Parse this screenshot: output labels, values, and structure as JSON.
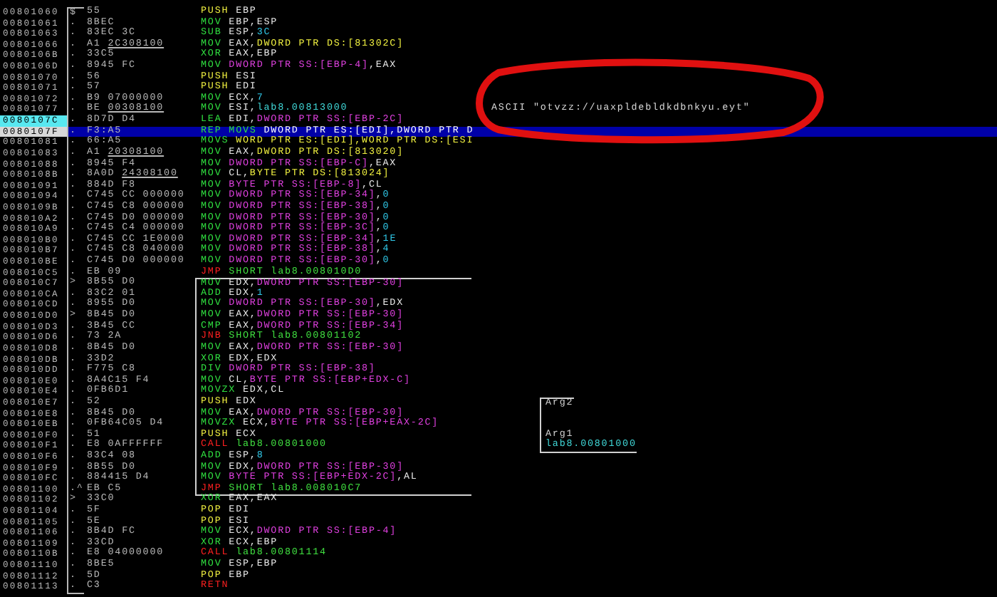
{
  "listing": {
    "function_bracket": true,
    "annotation": {
      "kind": "circle",
      "color": "#e01010"
    },
    "rows": [
      {
        "kind": "plain",
        "address": "00801060",
        "mark": "$",
        "hex": "55",
        "op": {
          "text": "PUSH",
          "kind": "stack"
        },
        "args": [
          {
            "text": "EBP",
            "kind": "register"
          }
        ],
        "selected": false,
        "address_highlight": false
      },
      {
        "kind": "plain",
        "address": "00801061",
        "mark": ".",
        "hex": "8BEC",
        "op": {
          "text": "MOV",
          "kind": "move"
        },
        "args": [
          {
            "text": "EBP,ESP",
            "kind": "register"
          }
        ],
        "selected": false,
        "address_highlight": false
      },
      {
        "kind": "plain",
        "address": "00801063",
        "mark": ".",
        "hex": "83EC 3C",
        "op": {
          "text": "SUB",
          "kind": "move"
        },
        "args": [
          {
            "text": "ESP,",
            "kind": "register"
          },
          {
            "text": "3C",
            "kind": "immediate"
          }
        ],
        "selected": false,
        "address_highlight": false
      },
      {
        "kind": "plain",
        "address": "00801066",
        "mark": ".",
        "hex": "A1",
        "fixup": "2C308100",
        "op": {
          "text": "MOV",
          "kind": "move"
        },
        "args": [
          {
            "text": "EAX,",
            "kind": "register"
          },
          {
            "text": "DWORD PTR DS:[81302C]",
            "kind": "global"
          }
        ],
        "selected": false,
        "address_highlight": false
      },
      {
        "kind": "plain",
        "address": "0080106B",
        "mark": ".",
        "hex": "33C5",
        "op": {
          "text": "XOR",
          "kind": "move"
        },
        "args": [
          {
            "text": "EAX,EBP",
            "kind": "register"
          }
        ],
        "selected": false,
        "address_highlight": false
      },
      {
        "kind": "plain",
        "address": "0080106D",
        "mark": ".",
        "hex": "8945 FC",
        "op": {
          "text": "MOV",
          "kind": "move"
        },
        "args": [
          {
            "text": "DWORD PTR SS:[EBP-4]",
            "kind": "memory"
          },
          {
            "text": ",EAX",
            "kind": "register"
          }
        ],
        "selected": false,
        "address_highlight": false
      },
      {
        "kind": "plain",
        "address": "00801070",
        "mark": ".",
        "hex": "56",
        "op": {
          "text": "PUSH",
          "kind": "stack"
        },
        "args": [
          {
            "text": "ESI",
            "kind": "register"
          }
        ],
        "selected": false,
        "address_highlight": false
      },
      {
        "kind": "plain",
        "address": "00801071",
        "mark": ".",
        "hex": "57",
        "op": {
          "text": "PUSH",
          "kind": "stack"
        },
        "args": [
          {
            "text": "EDI",
            "kind": "register"
          }
        ],
        "selected": false,
        "address_highlight": false
      },
      {
        "kind": "plain",
        "address": "00801072",
        "mark": ".",
        "hex": "B9 07000000",
        "op": {
          "text": "MOV",
          "kind": "move"
        },
        "args": [
          {
            "text": "ECX,",
            "kind": "register"
          },
          {
            "text": "7",
            "kind": "immediate"
          }
        ],
        "selected": false,
        "address_highlight": false
      },
      {
        "kind": "plain",
        "address": "00801077",
        "mark": ".",
        "hex": "BE",
        "fixup": "00308100",
        "op": {
          "text": "MOV",
          "kind": "move"
        },
        "args": [
          {
            "text": "ESI,",
            "kind": "register"
          },
          {
            "text": "lab8.00813000",
            "kind": "symbol"
          }
        ],
        "comment": {
          "text": "ASCII \"otvzz://uaxpldebldkdbnkyu.eyt\"",
          "kind": "ascii"
        },
        "selected": false,
        "address_highlight": false
      },
      {
        "kind": "plain",
        "address": "0080107C",
        "mark": ".",
        "hex": "8D7D D4",
        "op": {
          "text": "LEA",
          "kind": "move"
        },
        "args": [
          {
            "text": "EDI,",
            "kind": "register"
          },
          {
            "text": "DWORD PTR SS:[EBP-2C]",
            "kind": "memory"
          }
        ],
        "selected": false,
        "address_highlight": true
      },
      {
        "kind": "plain",
        "address": "0080107F",
        "mark": ".",
        "hex": "F3:A5",
        "op": {
          "text": "REP MOVS",
          "kind": "move"
        },
        "args": [
          {
            "text": "DWORD PTR ES:[EDI],DWORD PTR D",
            "kind": "register"
          }
        ],
        "selected": true,
        "address_highlight": false
      },
      {
        "kind": "plain",
        "address": "00801081",
        "mark": ".",
        "hex": "66:A5",
        "op": {
          "text": "MOVS",
          "kind": "move"
        },
        "args": [
          {
            "text": "WORD PTR ES:[EDI],WORD PTR DS:[ESI",
            "kind": "global"
          }
        ],
        "selected": false,
        "address_highlight": false
      },
      {
        "kind": "plain",
        "address": "00801083",
        "mark": ".",
        "hex": "A1",
        "fixup": "20308100",
        "op": {
          "text": "MOV",
          "kind": "move"
        },
        "args": [
          {
            "text": "EAX,",
            "kind": "register"
          },
          {
            "text": "DWORD PTR DS:[813020]",
            "kind": "global"
          }
        ],
        "selected": false,
        "address_highlight": false
      },
      {
        "kind": "plain",
        "address": "00801088",
        "mark": ".",
        "hex": "8945 F4",
        "op": {
          "text": "MOV",
          "kind": "move"
        },
        "args": [
          {
            "text": "DWORD PTR SS:[EBP-C]",
            "kind": "memory"
          },
          {
            "text": ",EAX",
            "kind": "register"
          }
        ],
        "selected": false,
        "address_highlight": false
      },
      {
        "kind": "plain",
        "address": "0080108B",
        "mark": ".",
        "hex": "8A0D",
        "fixup": "24308100",
        "op": {
          "text": "MOV",
          "kind": "move"
        },
        "args": [
          {
            "text": "CL,",
            "kind": "register"
          },
          {
            "text": "BYTE PTR DS:[813024]",
            "kind": "global"
          }
        ],
        "selected": false,
        "address_highlight": false
      },
      {
        "kind": "plain",
        "address": "00801091",
        "mark": ".",
        "hex": "884D F8",
        "op": {
          "text": "MOV",
          "kind": "move"
        },
        "args": [
          {
            "text": "BYTE PTR SS:[EBP-8]",
            "kind": "memory"
          },
          {
            "text": ",CL",
            "kind": "register"
          }
        ],
        "selected": false,
        "address_highlight": false
      },
      {
        "kind": "plain",
        "address": "00801094",
        "mark": ".",
        "hex": "C745 CC 000000",
        "op": {
          "text": "MOV",
          "kind": "move"
        },
        "args": [
          {
            "text": "DWORD PTR SS:[EBP-34]",
            "kind": "memory"
          },
          {
            "text": ",",
            "kind": "register"
          },
          {
            "text": "0",
            "kind": "immediate"
          }
        ],
        "selected": false,
        "address_highlight": false
      },
      {
        "kind": "plain",
        "address": "0080109B",
        "mark": ".",
        "hex": "C745 C8 000000",
        "op": {
          "text": "MOV",
          "kind": "move"
        },
        "args": [
          {
            "text": "DWORD PTR SS:[EBP-38]",
            "kind": "memory"
          },
          {
            "text": ",",
            "kind": "register"
          },
          {
            "text": "0",
            "kind": "immediate"
          }
        ],
        "selected": false,
        "address_highlight": false
      },
      {
        "kind": "plain",
        "address": "008010A2",
        "mark": ".",
        "hex": "C745 D0 000000",
        "op": {
          "text": "MOV",
          "kind": "move"
        },
        "args": [
          {
            "text": "DWORD PTR SS:[EBP-30]",
            "kind": "memory"
          },
          {
            "text": ",",
            "kind": "register"
          },
          {
            "text": "0",
            "kind": "immediate"
          }
        ],
        "selected": false,
        "address_highlight": false
      },
      {
        "kind": "plain",
        "address": "008010A9",
        "mark": ".",
        "hex": "C745 C4 000000",
        "op": {
          "text": "MOV",
          "kind": "move"
        },
        "args": [
          {
            "text": "DWORD PTR SS:[EBP-3C]",
            "kind": "memory"
          },
          {
            "text": ",",
            "kind": "register"
          },
          {
            "text": "0",
            "kind": "immediate"
          }
        ],
        "selected": false,
        "address_highlight": false
      },
      {
        "kind": "plain",
        "address": "008010B0",
        "mark": ".",
        "hex": "C745 CC 1E0000",
        "op": {
          "text": "MOV",
          "kind": "move"
        },
        "args": [
          {
            "text": "DWORD PTR SS:[EBP-34]",
            "kind": "memory"
          },
          {
            "text": ",",
            "kind": "register"
          },
          {
            "text": "1E",
            "kind": "immediate"
          }
        ],
        "selected": false,
        "address_highlight": false
      },
      {
        "kind": "plain",
        "address": "008010B7",
        "mark": ".",
        "hex": "C745 C8 040000",
        "op": {
          "text": "MOV",
          "kind": "move"
        },
        "args": [
          {
            "text": "DWORD PTR SS:[EBP-38]",
            "kind": "memory"
          },
          {
            "text": ",",
            "kind": "register"
          },
          {
            "text": "4",
            "kind": "immediate"
          }
        ],
        "selected": false,
        "address_highlight": false
      },
      {
        "kind": "plain",
        "address": "008010BE",
        "mark": ".",
        "hex": "C745 D0 000000",
        "op": {
          "text": "MOV",
          "kind": "move"
        },
        "args": [
          {
            "text": "DWORD PTR SS:[EBP-30]",
            "kind": "memory"
          },
          {
            "text": ",",
            "kind": "register"
          },
          {
            "text": "0",
            "kind": "immediate"
          }
        ],
        "selected": false,
        "address_highlight": false
      },
      {
        "kind": "plain",
        "address": "008010C5",
        "mark": ".",
        "hex": "EB 09",
        "op": {
          "text": "JMP",
          "kind": "jump"
        },
        "args": [
          {
            "text": "SHORT lab8.008010D0",
            "kind": "target"
          }
        ],
        "selected": false,
        "address_highlight": false
      },
      {
        "kind": "loopstart",
        "address": "008010C7",
        "mark": ">",
        "hex": "8B55 D0",
        "op": {
          "text": "MOV",
          "kind": "move"
        },
        "args": [
          {
            "text": "EDX,",
            "kind": "register"
          },
          {
            "text": "DWORD PTR SS:[EBP-30]",
            "kind": "memory"
          }
        ],
        "selected": false,
        "address_highlight": false
      },
      {
        "kind": "loop",
        "address": "008010CA",
        "mark": ".",
        "hex": "83C2 01",
        "op": {
          "text": "ADD",
          "kind": "move"
        },
        "args": [
          {
            "text": "EDX,",
            "kind": "register"
          },
          {
            "text": "1",
            "kind": "immediate"
          }
        ],
        "selected": false,
        "address_highlight": false
      },
      {
        "kind": "loop",
        "address": "008010CD",
        "mark": ".",
        "hex": "8955 D0",
        "op": {
          "text": "MOV",
          "kind": "move"
        },
        "args": [
          {
            "text": "DWORD PTR SS:[EBP-30]",
            "kind": "memory"
          },
          {
            "text": ",EDX",
            "kind": "register"
          }
        ],
        "selected": false,
        "address_highlight": false
      },
      {
        "kind": "loop",
        "address": "008010D0",
        "mark": ">",
        "hex": "8B45 D0",
        "op": {
          "text": "MOV",
          "kind": "move"
        },
        "args": [
          {
            "text": "EAX,",
            "kind": "register"
          },
          {
            "text": "DWORD PTR SS:[EBP-30]",
            "kind": "memory"
          }
        ],
        "selected": false,
        "address_highlight": false
      },
      {
        "kind": "loop",
        "address": "008010D3",
        "mark": ".",
        "hex": "3B45 CC",
        "op": {
          "text": "CMP",
          "kind": "move"
        },
        "args": [
          {
            "text": "EAX,",
            "kind": "register"
          },
          {
            "text": "DWORD PTR SS:[EBP-34]",
            "kind": "memory"
          }
        ],
        "selected": false,
        "address_highlight": false
      },
      {
        "kind": "loop",
        "address": "008010D6",
        "mark": ".",
        "hex": "73 2A",
        "op": {
          "text": "JNB",
          "kind": "jump"
        },
        "args": [
          {
            "text": "SHORT lab8.00801102",
            "kind": "target"
          }
        ],
        "selected": false,
        "address_highlight": false
      },
      {
        "kind": "loop",
        "address": "008010D8",
        "mark": ".",
        "hex": "8B45 D0",
        "op": {
          "text": "MOV",
          "kind": "move"
        },
        "args": [
          {
            "text": "EAX,",
            "kind": "register"
          },
          {
            "text": "DWORD PTR SS:[EBP-30]",
            "kind": "memory"
          }
        ],
        "selected": false,
        "address_highlight": false
      },
      {
        "kind": "loop",
        "address": "008010DB",
        "mark": ".",
        "hex": "33D2",
        "op": {
          "text": "XOR",
          "kind": "move"
        },
        "args": [
          {
            "text": "EDX,EDX",
            "kind": "register"
          }
        ],
        "selected": false,
        "address_highlight": false
      },
      {
        "kind": "loop",
        "address": "008010DD",
        "mark": ".",
        "hex": "F775 C8",
        "op": {
          "text": "DIV",
          "kind": "move"
        },
        "args": [
          {
            "text": "DWORD PTR SS:[EBP-38]",
            "kind": "memory"
          }
        ],
        "selected": false,
        "address_highlight": false
      },
      {
        "kind": "loop",
        "address": "008010E0",
        "mark": ".",
        "hex": "8A4C15 F4",
        "op": {
          "text": "MOV",
          "kind": "move"
        },
        "args": [
          {
            "text": "CL,",
            "kind": "register"
          },
          {
            "text": "BYTE PTR SS:[EBP+EDX-C]",
            "kind": "memory"
          }
        ],
        "selected": false,
        "address_highlight": false
      },
      {
        "kind": "loop",
        "address": "008010E4",
        "mark": ".",
        "hex": "0FB6D1",
        "op": {
          "text": "MOVZX",
          "kind": "move"
        },
        "args": [
          {
            "text": "EDX,CL",
            "kind": "register"
          }
        ],
        "selected": false,
        "address_highlight": false
      },
      {
        "kind": "loop",
        "address": "008010E7",
        "mark": ".",
        "hex": "52",
        "op": {
          "text": "PUSH",
          "kind": "stack"
        },
        "args": [
          {
            "text": "EDX",
            "kind": "register"
          }
        ],
        "comment": {
          "text": "Arg2",
          "kind": "open"
        },
        "selected": false,
        "address_highlight": false
      },
      {
        "kind": "loop",
        "address": "008010E8",
        "mark": ".",
        "hex": "8B45 D0",
        "op": {
          "text": "MOV",
          "kind": "move"
        },
        "args": [
          {
            "text": "EAX,",
            "kind": "register"
          },
          {
            "text": "DWORD PTR SS:[EBP-30]",
            "kind": "memory"
          }
        ],
        "comment": {
          "kind": "inner"
        },
        "selected": false,
        "address_highlight": false
      },
      {
        "kind": "loop",
        "address": "008010EB",
        "mark": ".",
        "hex": "0FB64C05 D4",
        "op": {
          "text": "MOVZX",
          "kind": "move"
        },
        "args": [
          {
            "text": "ECX,",
            "kind": "register"
          },
          {
            "text": "BYTE PTR SS:[EBP+EAX-2C]",
            "kind": "memory"
          }
        ],
        "comment": {
          "kind": "inner"
        },
        "selected": false,
        "address_highlight": false
      },
      {
        "kind": "loop",
        "address": "008010F0",
        "mark": ".",
        "hex": "51",
        "op": {
          "text": "PUSH",
          "kind": "stack"
        },
        "args": [
          {
            "text": "ECX",
            "kind": "register"
          }
        ],
        "comment": {
          "text": "Arg1",
          "kind": "inner"
        },
        "selected": false,
        "address_highlight": false
      },
      {
        "kind": "loop",
        "address": "008010F1",
        "mark": ".",
        "hex": "E8 0AFFFFFF",
        "op": {
          "text": "CALL",
          "kind": "call"
        },
        "args": [
          {
            "text": "lab8.00801000",
            "kind": "target"
          }
        ],
        "comment": {
          "text": "lab8.00801000",
          "kind": "close"
        },
        "selected": false,
        "address_highlight": false
      },
      {
        "kind": "loop",
        "address": "008010F6",
        "mark": ".",
        "hex": "83C4 08",
        "op": {
          "text": "ADD",
          "kind": "move"
        },
        "args": [
          {
            "text": "ESP,",
            "kind": "register"
          },
          {
            "text": "8",
            "kind": "immediate"
          }
        ],
        "selected": false,
        "address_highlight": false
      },
      {
        "kind": "loop",
        "address": "008010F9",
        "mark": ".",
        "hex": "8B55 D0",
        "op": {
          "text": "MOV",
          "kind": "move"
        },
        "args": [
          {
            "text": "EDX,",
            "kind": "register"
          },
          {
            "text": "DWORD PTR SS:[EBP-30]",
            "kind": "memory"
          }
        ],
        "selected": false,
        "address_highlight": false
      },
      {
        "kind": "loop",
        "address": "008010FC",
        "mark": ".",
        "hex": "884415 D4",
        "op": {
          "text": "MOV",
          "kind": "move"
        },
        "args": [
          {
            "text": "BYTE PTR SS:[EBP+EDX-2C]",
            "kind": "memory"
          },
          {
            "text": ",AL",
            "kind": "register"
          }
        ],
        "selected": false,
        "address_highlight": false
      },
      {
        "kind": "loopend",
        "address": "00801100",
        "mark": ".^",
        "hex": "EB C5",
        "op": {
          "text": "JMP",
          "kind": "jump"
        },
        "args": [
          {
            "text": "SHORT lab8.008010C7",
            "kind": "target"
          }
        ],
        "selected": false,
        "address_highlight": false
      },
      {
        "kind": "plain",
        "address": "00801102",
        "mark": ">",
        "hex": "33C0",
        "op": {
          "text": "XOR",
          "kind": "move"
        },
        "args": [
          {
            "text": "EAX,EAX",
            "kind": "register"
          }
        ],
        "selected": false,
        "address_highlight": false
      },
      {
        "kind": "plain",
        "address": "00801104",
        "mark": ".",
        "hex": "5F",
        "op": {
          "text": "POP",
          "kind": "stack"
        },
        "args": [
          {
            "text": "EDI",
            "kind": "register"
          }
        ],
        "selected": false,
        "address_highlight": false
      },
      {
        "kind": "plain",
        "address": "00801105",
        "mark": ".",
        "hex": "5E",
        "op": {
          "text": "POP",
          "kind": "stack"
        },
        "args": [
          {
            "text": "ESI",
            "kind": "register"
          }
        ],
        "selected": false,
        "address_highlight": false
      },
      {
        "kind": "plain",
        "address": "00801106",
        "mark": ".",
        "hex": "8B4D FC",
        "op": {
          "text": "MOV",
          "kind": "move"
        },
        "args": [
          {
            "text": "ECX,",
            "kind": "register"
          },
          {
            "text": "DWORD PTR SS:[EBP-4]",
            "kind": "memory"
          }
        ],
        "selected": false,
        "address_highlight": false
      },
      {
        "kind": "plain",
        "address": "00801109",
        "mark": ".",
        "hex": "33CD",
        "op": {
          "text": "XOR",
          "kind": "move"
        },
        "args": [
          {
            "text": "ECX,EBP",
            "kind": "register"
          }
        ],
        "selected": false,
        "address_highlight": false
      },
      {
        "kind": "plain",
        "address": "0080110B",
        "mark": ".",
        "hex": "E8 04000000",
        "op": {
          "text": "CALL",
          "kind": "call"
        },
        "args": [
          {
            "text": "lab8.00801114",
            "kind": "target"
          }
        ],
        "selected": false,
        "address_highlight": false
      },
      {
        "kind": "plain",
        "address": "00801110",
        "mark": ".",
        "hex": "8BE5",
        "op": {
          "text": "MOV",
          "kind": "move"
        },
        "args": [
          {
            "text": "ESP,EBP",
            "kind": "register"
          }
        ],
        "selected": false,
        "address_highlight": false
      },
      {
        "kind": "plain",
        "address": "00801112",
        "mark": ".",
        "hex": "5D",
        "op": {
          "text": "POP",
          "kind": "stack"
        },
        "args": [
          {
            "text": "EBP",
            "kind": "register"
          }
        ],
        "selected": false,
        "address_highlight": false
      },
      {
        "kind": "plain",
        "address": "00801113",
        "mark": ".",
        "hex": "C3",
        "op": {
          "text": "RETN",
          "kind": "ret"
        },
        "args": [],
        "selected": false,
        "address_highlight": false
      }
    ]
  }
}
